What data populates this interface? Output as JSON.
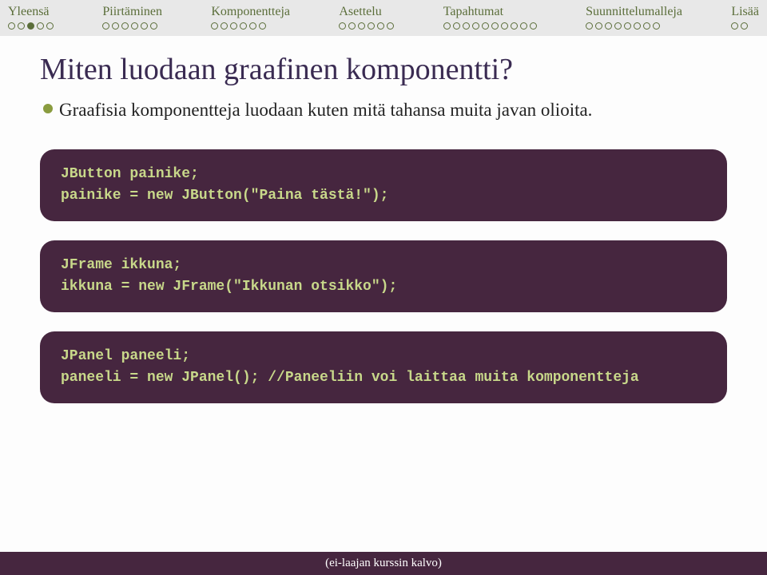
{
  "nav": [
    {
      "label": "Yleensä",
      "total": 5,
      "filled_index": 2
    },
    {
      "label": "Piirtäminen",
      "total": 6,
      "filled_index": -1
    },
    {
      "label": "Komponentteja",
      "total": 6,
      "filled_index": -1
    },
    {
      "label": "Asettelu",
      "total": 6,
      "filled_index": -1
    },
    {
      "label": "Tapahtumat",
      "total": 10,
      "filled_index": -1
    },
    {
      "label": "Suunnittelumalleja",
      "total": 8,
      "filled_index": -1
    },
    {
      "label": "Lisää",
      "total": 2,
      "filled_index": -1
    }
  ],
  "title": "Miten luodaan graafinen komponentti?",
  "bullet": "Graafisia komponentteja luodaan kuten mitä tahansa muita javan olioita.",
  "code": [
    "JButton painike;\npainike = new JButton(\"Paina tästä!\");",
    "JFrame ikkuna;\nikkuna = new JFrame(\"Ikkunan otsikko\");",
    "JPanel paneeli;\npaneeli = new JPanel(); //Paneeliin voi laittaa muita komponentteja"
  ],
  "footer": "(ei-laajan kurssin kalvo)"
}
